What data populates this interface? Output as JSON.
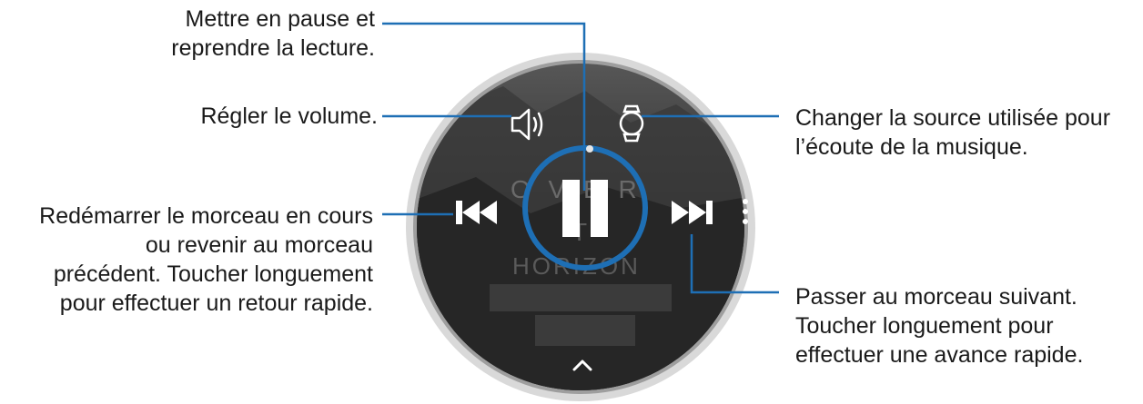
{
  "callouts": {
    "pause": {
      "line1": "Mettre en pause et",
      "line2": "reprendre la lecture."
    },
    "volume": "Régler le volume.",
    "source": {
      "line1": "Changer la source utilisée pour",
      "line2": "l’écoute de la musique."
    },
    "previous": {
      "line1": "Redémarrer le morceau en cours",
      "line2": "ou revenir au morceau",
      "line3": "précédent. Toucher longuement",
      "line4": "pour effectuer un retour rapide."
    },
    "next": {
      "line1": "Passer au morceau suivant.",
      "line2": "Toucher longuement pour",
      "line3": "effectuer une avance rapide."
    }
  },
  "watch": {
    "track_text_line1": "O V E R",
    "track_text_line2": "T",
    "track_text_line3": "HORIZON",
    "progress": 0.02,
    "accent_color": "#1e6fb5",
    "icons": [
      "speaker-icon",
      "watch-icon",
      "previous-icon",
      "pause-icon",
      "next-icon",
      "more-icon",
      "chevron-up-icon"
    ]
  }
}
